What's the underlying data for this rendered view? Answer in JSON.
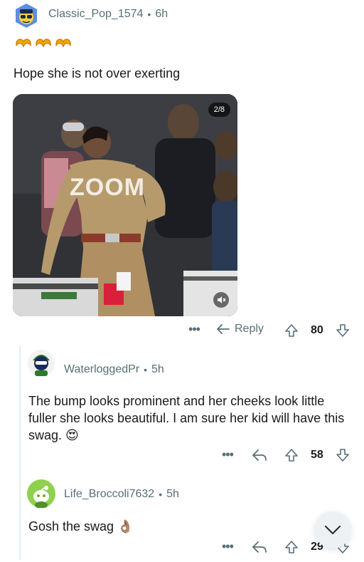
{
  "comments": [
    {
      "username": "Classic_Pop_1574",
      "time": "6h",
      "awards": [
        "heart-hands-award",
        "heart-hands-award",
        "heart-hands-award"
      ],
      "text": "Hope she is not over exerting",
      "media": {
        "counter": "2/8",
        "watermark": "ZOOM"
      },
      "reply_label": "Reply",
      "votes": "80"
    },
    {
      "username": "WaterloggedPr",
      "time": "5h",
      "text": "The bump looks prominent and her cheeks look little fuller she looks beautiful. I am sure her kid will have this swag. 😍",
      "votes": "58"
    },
    {
      "username": "Life_Broccoli7632",
      "time": "5h",
      "text": "Gosh the swag 👌🏽",
      "votes": "29"
    }
  ],
  "colors": {
    "meta": "#576f76",
    "text": "#1a1a1b",
    "thread": "#e5ebee",
    "fab": "#eef1f3"
  }
}
